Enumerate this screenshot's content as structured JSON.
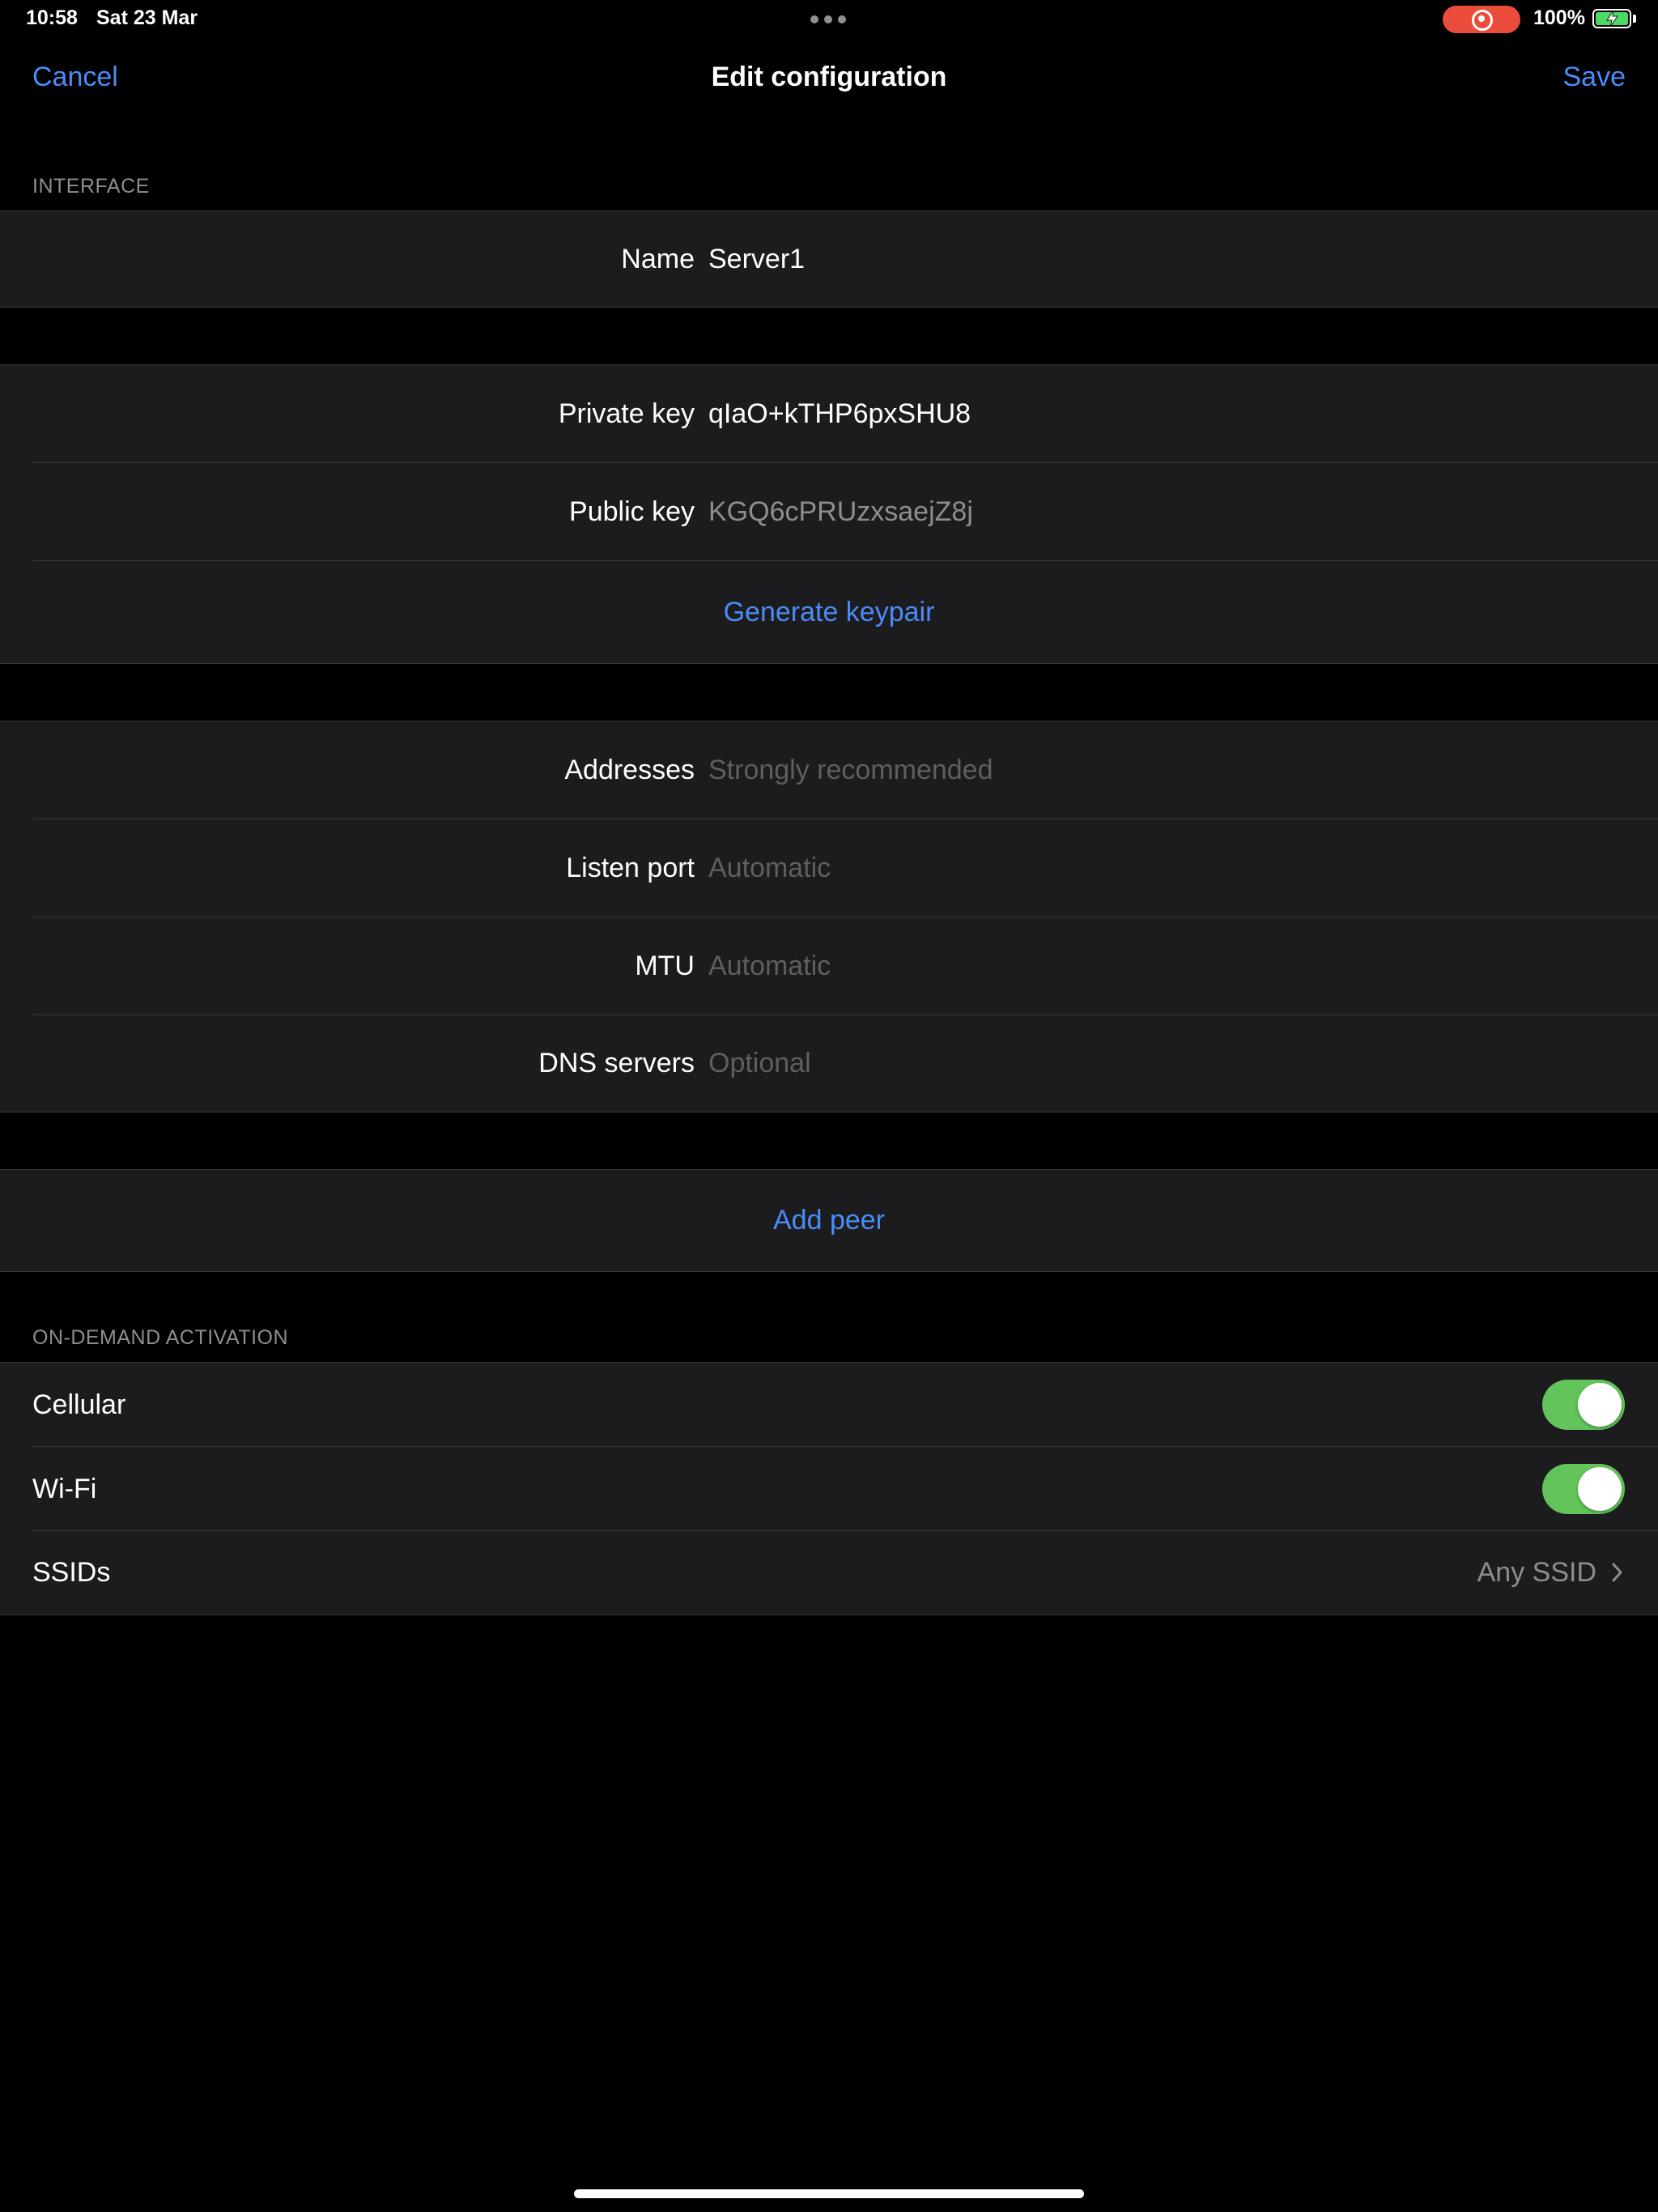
{
  "status_bar": {
    "time": "10:58",
    "date": "Sat 23 Mar",
    "battery_percent": "100%",
    "battery_level": 1.0,
    "recording_color": "#eb4d3d"
  },
  "nav": {
    "cancel_label": "Cancel",
    "title": "Edit configuration",
    "save_label": "Save"
  },
  "interface": {
    "section_title": "INTERFACE",
    "name_label": "Name",
    "name_value": "Server1",
    "private_key_label": "Private key",
    "private_key_value": "qIaO+kTHP6pxSHU8",
    "public_key_label": "Public key",
    "public_key_value": "KGQ6cPRUzxsaejZ8j",
    "generate_keypair_label": "Generate keypair",
    "addresses_label": "Addresses",
    "addresses_placeholder": "Strongly recommended",
    "listen_port_label": "Listen port",
    "listen_port_placeholder": "Automatic",
    "mtu_label": "MTU",
    "mtu_placeholder": "Automatic",
    "dns_label": "DNS servers",
    "dns_placeholder": "Optional"
  },
  "peer": {
    "add_peer_label": "Add peer"
  },
  "on_demand": {
    "section_title": "ON-DEMAND ACTIVATION",
    "cellular_label": "Cellular",
    "cellular_on": true,
    "wifi_label": "Wi-Fi",
    "wifi_on": true,
    "ssids_label": "SSIDs",
    "ssids_value": "Any SSID"
  },
  "colors": {
    "accent": "#4a8cf7",
    "toggle_on": "#63c45b",
    "background": "#000000",
    "cell_background": "#1c1c1e"
  },
  "icons": {
    "chevron": "chevron-right-icon",
    "record": "screen-recording-icon",
    "battery": "battery-charging-icon"
  }
}
